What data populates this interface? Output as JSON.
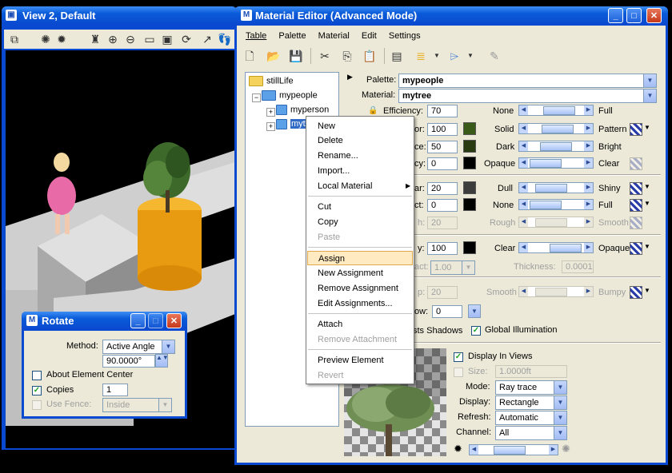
{
  "view_window": {
    "title": "View 2, Default"
  },
  "rotate_dialog": {
    "title": "Rotate",
    "method_label": "Method:",
    "method_value": "Active Angle",
    "angle_value": "90.0000°",
    "about_center_label": "About Element Center",
    "copies_label": "Copies",
    "copies_value": "1",
    "use_fence_label": "Use Fence:",
    "use_fence_value": "Inside"
  },
  "material_editor": {
    "title": "Material Editor (Advanced Mode)",
    "menu": [
      "Table",
      "Palette",
      "Material",
      "Edit",
      "Settings"
    ],
    "tree": {
      "root": "stillLife",
      "palette": "mypeople",
      "items": [
        "myperson",
        "mytree"
      ]
    },
    "palette_label": "Palette:",
    "palette_value": "mypeople",
    "material_label": "Material:",
    "material_value": "mytree",
    "efficiency_label": "Efficiency:",
    "efficiency_value": "70",
    "efficiency_left": "None",
    "efficiency_right": "Full",
    "color_label_partial": "or:",
    "color_value": "100",
    "color_left": "Solid",
    "color_right": "Pattern",
    "surface_label_partial": "ce:",
    "surface_value": "50",
    "surface_left": "Dark",
    "surface_right": "Bright",
    "transparency_label_partial": "cy:",
    "transparency_value": "0",
    "transparency_left": "Opaque",
    "transparency_right": "Clear",
    "specular_label_partial": "ar:",
    "specular_value": "20",
    "specular_left": "Dull",
    "specular_right": "Shiny",
    "reflect_label_partial": "ct:",
    "reflect_value": "0",
    "reflect_left": "None",
    "reflect_right": "Full",
    "finish_label_partial": "h:",
    "finish_value": "20",
    "finish_left": "Rough",
    "finish_right": "Smooth",
    "opacity_label_partial": "y:",
    "opacity_value": "100",
    "opacity_left": "Clear",
    "opacity_right": "Opaque",
    "refract_label_partial": "act:",
    "refract_value": "1.00",
    "thickness_label": "Thickness:",
    "thickness_value": "0.0001",
    "bump_label_partial": "p:",
    "bump_value": "20",
    "bump_left": "Smooth",
    "bump_right": "Bumpy",
    "glow_label_partial": "ow:",
    "glow_value": "0",
    "casts_shadows_label_partial": "sts Shadows",
    "global_illumination_label": "Global Illumination",
    "display_in_views_label": "Display In Views",
    "size_label": "Size:",
    "size_value": "1.0000ft",
    "mode_label": "Mode:",
    "mode_value": "Ray trace",
    "display_label": "Display:",
    "display_value": "Rectangle",
    "refresh_label": "Refresh:",
    "refresh_value": "Automatic",
    "channel_label": "Channel:",
    "channel_value": "All",
    "sliders": {
      "efficiency": 0.62,
      "color": 0.55,
      "surface": 0.5,
      "transparency": 0.05,
      "specular": 0.3,
      "reflect": 0.05,
      "finish": 0.3,
      "opacity": 0.9,
      "bump": 0.3,
      "preview_light": 0.4
    }
  },
  "context_menu": {
    "items": [
      {
        "label": "New",
        "disabled": false
      },
      {
        "label": "Delete",
        "disabled": false
      },
      {
        "label": "Rename...",
        "disabled": false
      },
      {
        "label": "Import...",
        "disabled": false
      },
      {
        "label": "Local Material",
        "disabled": false,
        "submenu": true
      },
      {
        "label": "Cut",
        "disabled": false
      },
      {
        "label": "Copy",
        "disabled": false
      },
      {
        "label": "Paste",
        "disabled": true
      },
      {
        "label": "Assign",
        "disabled": false,
        "selected": true
      },
      {
        "label": "New Assignment",
        "disabled": false
      },
      {
        "label": "Remove Assignment",
        "disabled": false
      },
      {
        "label": "Edit Assignments...",
        "disabled": false
      },
      {
        "label": "Attach",
        "disabled": false
      },
      {
        "label": "Remove Attachment",
        "disabled": true
      },
      {
        "label": "Preview Element",
        "disabled": false
      },
      {
        "label": "Revert",
        "disabled": true
      }
    ]
  },
  "colors": {
    "title_blue": "#0a4ad0",
    "dialog_bg": "#ece9d8",
    "menu_highlight": "#ffeac1",
    "cylinder_orange": "#e89a10"
  }
}
